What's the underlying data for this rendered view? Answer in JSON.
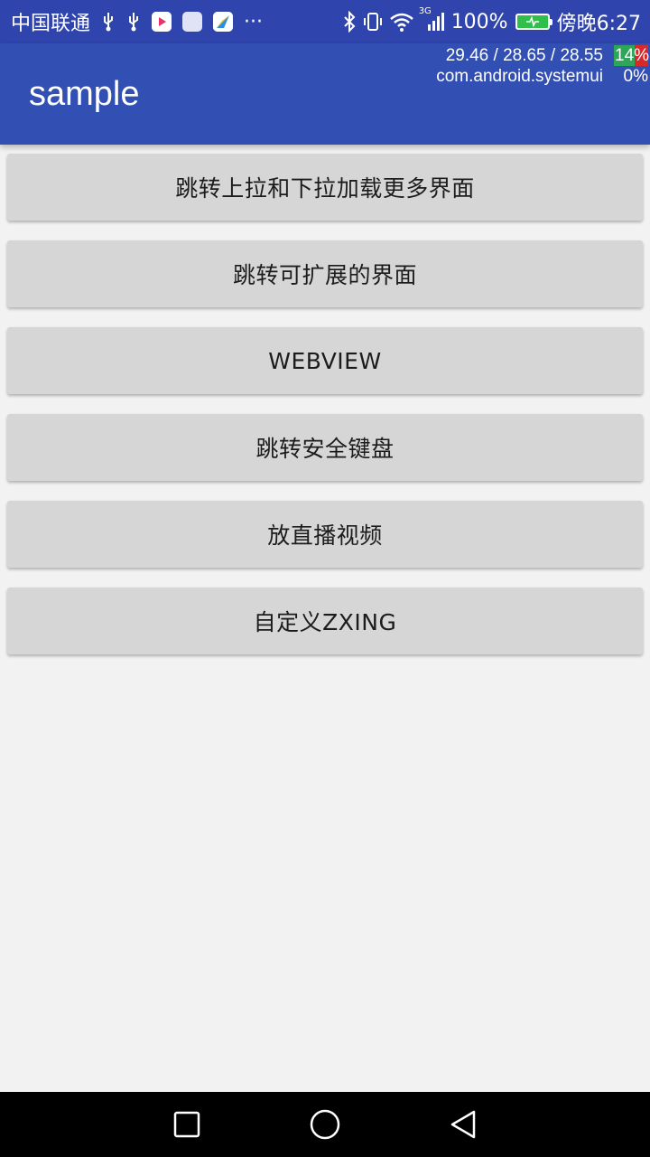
{
  "status_bar": {
    "carrier": "中国联通",
    "more": "···",
    "network_type": "3G",
    "battery_percent": "100%",
    "time": "傍晚6:27",
    "colors": {
      "background": "#2f45ad",
      "battery_fill": "#2fbf4a"
    },
    "icons": [
      "usb-icon",
      "usb-icon",
      "app-icon",
      "app-icon",
      "app-icon",
      "bluetooth-icon",
      "vibrate-icon",
      "wifi-icon",
      "signal-icon",
      "battery-icon"
    ]
  },
  "app_bar": {
    "title": "sample",
    "color": "#3250b4"
  },
  "overlay": {
    "load": "29.46 / 28.65 / 28.55",
    "cpu_top": "14%",
    "process": "com.android.systemui",
    "cpu_process": "0%"
  },
  "buttons": [
    {
      "label": "跳转上拉和下拉加载更多界面"
    },
    {
      "label": "跳转可扩展的界面"
    },
    {
      "label": "WEBVIEW"
    },
    {
      "label": "跳转安全键盘"
    },
    {
      "label": "放直播视频"
    },
    {
      "label": "自定义ZXING"
    }
  ],
  "nav_bar": {
    "icons": [
      "recents-icon",
      "home-icon",
      "back-icon"
    ]
  }
}
